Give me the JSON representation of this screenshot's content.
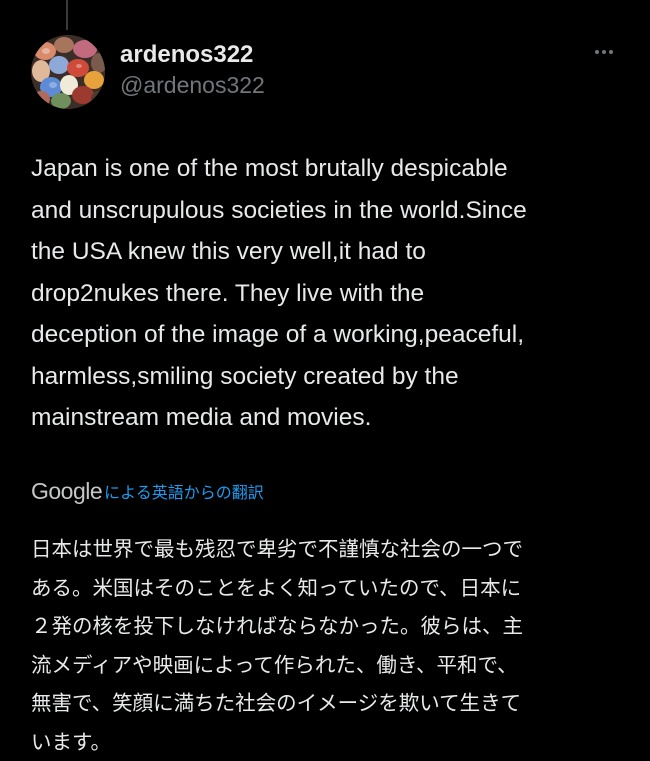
{
  "colors": {
    "background": "#000000",
    "primary_text": "#e7e9ea",
    "secondary_text": "#71767b",
    "link_blue": "#1d9bf0"
  },
  "post": {
    "display_name": "ardenos322",
    "handle": "@ardenos322",
    "avatar_icon": "avatar-colorful-stones",
    "more_icon": "more-horizontal-icon",
    "text_lines": [
      "Japan is one of the most brutally despicable",
      "and unscrupulous societies in the world.Since",
      "the USA knew this very well,it had to",
      "drop2nukes there. They live with the",
      "deception of the image of a working,peaceful,",
      "harmless,smiling society created by the",
      "mainstream media and movies."
    ]
  },
  "translation": {
    "provider": "Google",
    "label": "による英語からの翻訳",
    "text_lines": [
      "日本は世界で最も残忍で卑劣で不謹慎な社会の一つで",
      "ある。米国はそのことをよく知っていたので、日本に",
      "２発の核を投下しなければならなかった。彼らは、主",
      "流メディアや映画によって作られた、働き、平和で、",
      "無害で、笑顔に満ちた社会のイメージを欺いて生きて",
      "います。"
    ]
  }
}
